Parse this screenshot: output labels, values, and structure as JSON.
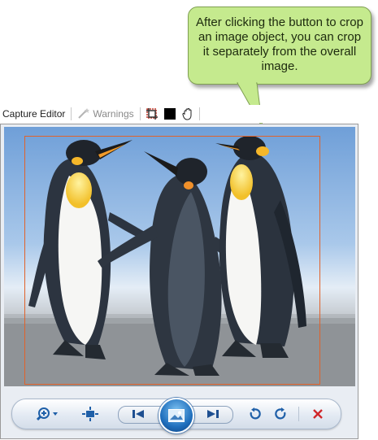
{
  "callout": {
    "text": "After clicking the button to crop an image object, you can crop it separately from the overall image."
  },
  "toolbar": {
    "title": "Capture Editor",
    "warnings_label": "Warnings",
    "icons": [
      "crop-object-icon",
      "color-swatch-icon",
      "hand-pan-icon"
    ]
  },
  "colors": {
    "callout_fill": "#c5ea8e",
    "crop_outline": "#e0622b",
    "swatch": "#000000"
  },
  "bottom_bar": {
    "buttons": [
      "zoom-icon",
      "fit-to-window-icon",
      "previous-icon",
      "view-image-icon",
      "next-icon",
      "rotate-left-icon",
      "rotate-right-icon",
      "delete-icon"
    ]
  }
}
